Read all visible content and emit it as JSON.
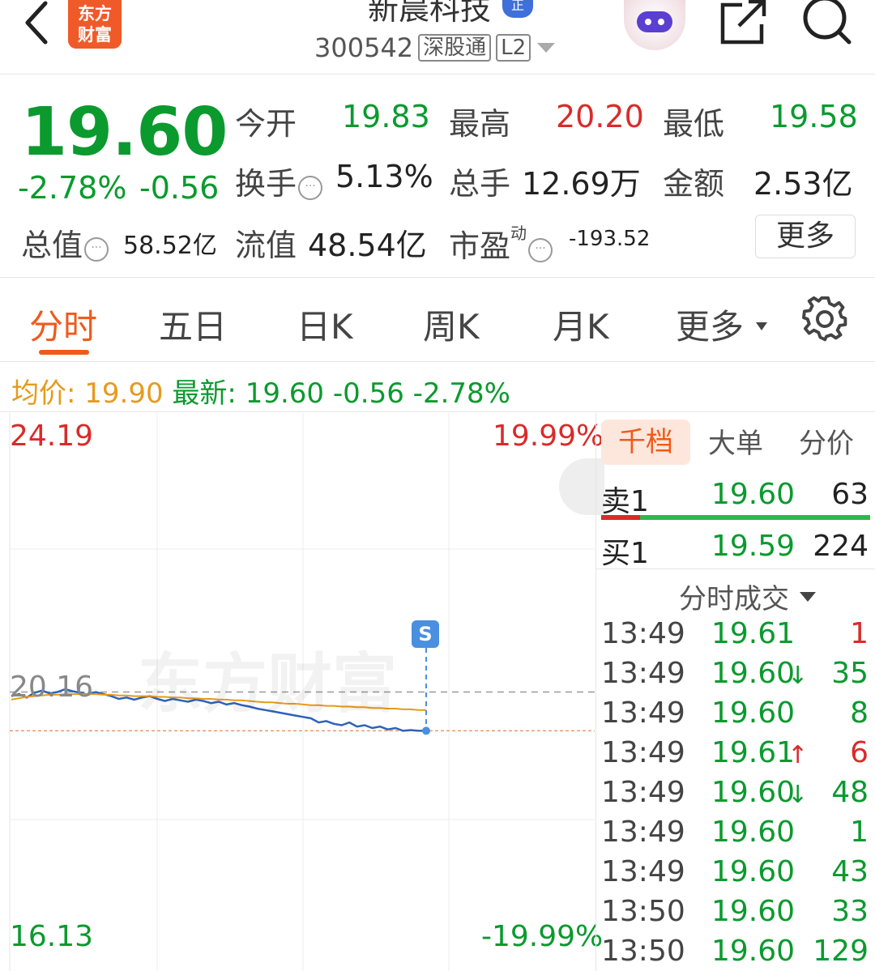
{
  "header": {
    "logo_text": [
      "东方",
      "财富"
    ],
    "stock_name": "新晨科技",
    "verified_badge": "正",
    "stock_code": "300542",
    "tags": [
      "深股通",
      "L2"
    ]
  },
  "quote": {
    "price": "19.60",
    "change_pct": "-2.78%",
    "change_amt": "-0.56",
    "fields": {
      "open_label": "今开",
      "open": "19.83",
      "high_label": "最高",
      "high": "20.20",
      "low_label": "最低",
      "low": "19.58",
      "turnover_label": "换手",
      "turnover": "5.13%",
      "volume_label": "总手",
      "volume": "12.69万",
      "amount_label": "金额",
      "amount": "2.53亿",
      "mktcap_label": "总值",
      "mktcap": "58.52亿",
      "float_label": "流值",
      "float": "48.54亿",
      "pe_label": "市盈",
      "pe_sup": "动",
      "pe": "-193.52"
    },
    "more_label": "更多"
  },
  "tabs": [
    "分时",
    "五日",
    "日K",
    "周K",
    "月K",
    "更多"
  ],
  "legend": {
    "avg_label": "均价:",
    "avg": "19.90",
    "latest_label": "最新:",
    "latest": "19.60",
    "chg": "-0.56",
    "chg_pct": "-2.78%"
  },
  "chart_data": {
    "type": "line",
    "y_top_label": "24.19",
    "y_bottom_label": "16.13",
    "pct_top_label": "19.99%",
    "pct_bottom_label": "-19.99%",
    "prev_close_label": "20.16",
    "ylim": [
      16.13,
      24.19
    ],
    "prev_close": 20.16,
    "last_price": 19.6,
    "marker_label": "S",
    "watermark": "东方财富",
    "series": [
      {
        "name": "",
        "color": "#2e62b8",
        "values": [
          20.1,
          20.13,
          20.08,
          20.15,
          20.18,
          20.14,
          20.16,
          20.2,
          20.17,
          20.15,
          20.12,
          20.16,
          20.13,
          20.1,
          20.06,
          20.08,
          20.05,
          20.08,
          20.1,
          20.06,
          20.03,
          20.06,
          20.04,
          20.02,
          20.05,
          20.03,
          20.0,
          20.02,
          19.98,
          20.0,
          19.97,
          19.95,
          19.92,
          19.9,
          19.88,
          19.86,
          19.84,
          19.82,
          19.8,
          19.78,
          19.72,
          19.74,
          19.7,
          19.68,
          19.72,
          19.66,
          19.68,
          19.64,
          19.66,
          19.62,
          19.64,
          19.6,
          19.61,
          19.6,
          19.6
        ]
      },
      {
        "name": "",
        "color": "#e79a1c",
        "values": [
          20.05,
          20.07,
          20.09,
          20.1,
          20.11,
          20.12,
          20.12,
          20.13,
          20.13,
          20.13,
          20.13,
          20.13,
          20.12,
          20.12,
          20.11,
          20.11,
          20.1,
          20.1,
          20.1,
          20.09,
          20.09,
          20.08,
          20.08,
          20.07,
          20.07,
          20.06,
          20.06,
          20.05,
          20.05,
          20.04,
          20.04,
          20.03,
          20.02,
          20.01,
          20.01,
          20.0,
          19.99,
          19.99,
          19.98,
          19.97,
          19.97,
          19.96,
          19.96,
          19.95,
          19.95,
          19.94,
          19.94,
          19.93,
          19.93,
          19.92,
          19.92,
          19.91,
          19.91,
          19.9,
          19.9
        ]
      }
    ]
  },
  "orderbook": {
    "tabs": [
      "千档",
      "大单",
      "分价"
    ],
    "sell": {
      "label": "卖1",
      "price": "19.60",
      "vol": "63"
    },
    "buy": {
      "label": "买1",
      "price": "19.59",
      "vol": "224"
    },
    "ticks_title": "分时成交",
    "ticks": [
      {
        "time": "13:49",
        "price": "19.61",
        "vol": "1",
        "dir": "",
        "color": "red"
      },
      {
        "time": "13:49",
        "price": "19.60",
        "vol": "35",
        "dir": "↓",
        "color": "green"
      },
      {
        "time": "13:49",
        "price": "19.60",
        "vol": "8",
        "dir": "",
        "color": "green"
      },
      {
        "time": "13:49",
        "price": "19.61",
        "vol": "6",
        "dir": "↑",
        "color": "red"
      },
      {
        "time": "13:49",
        "price": "19.60",
        "vol": "48",
        "dir": "↓",
        "color": "green"
      },
      {
        "time": "13:49",
        "price": "19.60",
        "vol": "1",
        "dir": "",
        "color": "green"
      },
      {
        "time": "13:49",
        "price": "19.60",
        "vol": "43",
        "dir": "",
        "color": "green"
      },
      {
        "time": "13:50",
        "price": "19.60",
        "vol": "33",
        "dir": "",
        "color": "green"
      },
      {
        "time": "13:50",
        "price": "19.60",
        "vol": "129",
        "dir": "",
        "color": "green"
      }
    ]
  }
}
